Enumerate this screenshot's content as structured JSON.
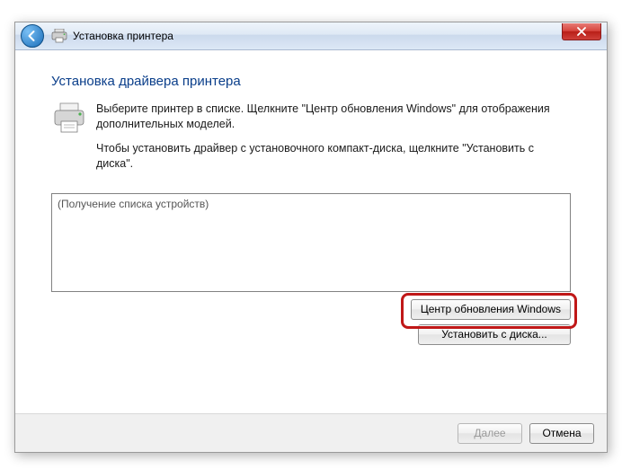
{
  "window": {
    "title": "Установка принтера"
  },
  "page": {
    "heading": "Установка драйвера принтера",
    "line1": "Выберите принтер в списке. Щелкните \"Центр обновления Windows\" для отображения дополнительных моделей.",
    "line2": "Чтобы установить драйвер с установочного компакт-диска, щелкните \"Установить с диска\"."
  },
  "list": {
    "status": "(Получение списка устройств)"
  },
  "buttons": {
    "windows_update": "Центр обновления Windows",
    "install_from_disk": "Установить с диска...",
    "next": "Далее",
    "cancel": "Отмена"
  }
}
